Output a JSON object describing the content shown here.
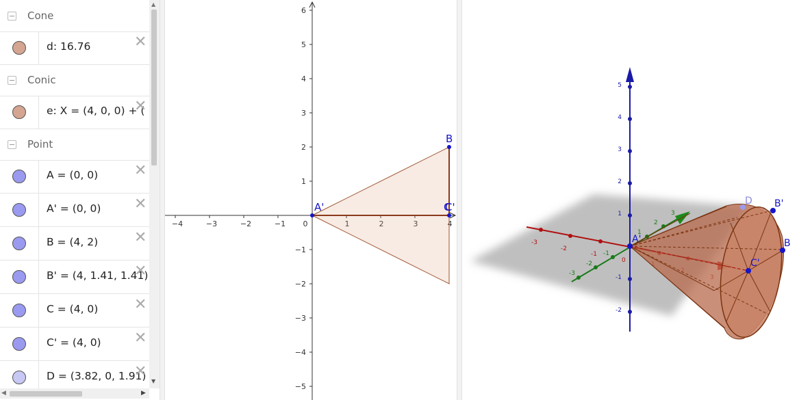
{
  "algebra": {
    "categories": [
      {
        "label": "Cone"
      },
      {
        "label": "Conic"
      },
      {
        "label": "Point"
      }
    ],
    "cone_items": [
      {
        "expr": "d: 16.76",
        "color": "#d4a590"
      }
    ],
    "conic_items": [
      {
        "expr": "e: X = (4, 0, 0) + (",
        "color": "#d4a590"
      }
    ],
    "point_items": [
      {
        "expr": "A = (0, 0)",
        "color": "#9a9af0"
      },
      {
        "expr": "A' = (0, 0)",
        "color": "#9a9af0"
      },
      {
        "expr": "B = (4, 2)",
        "color": "#9a9af0"
      },
      {
        "expr": "B' = (4, 1.41, 1.41)",
        "color": "#9a9af0"
      },
      {
        "expr": "C = (4, 0)",
        "color": "#9a9af0"
      },
      {
        "expr": "C' = (4, 0)",
        "color": "#9a9af0"
      },
      {
        "expr": "D = (3.82, 0, 1.91)",
        "color": "#c8c8f4"
      }
    ]
  },
  "graphics2d": {
    "x_ticks": [
      "−4",
      "−3",
      "−2",
      "−1",
      "0",
      "1",
      "2",
      "3",
      "4"
    ],
    "y_ticks_pos": [
      "6",
      "5",
      "4",
      "3",
      "2",
      "1"
    ],
    "y_ticks_neg": [
      "−1",
      "−2",
      "−3",
      "−4",
      "−5"
    ],
    "labels": {
      "A": "A'",
      "B": "B",
      "C": "C",
      "C2": "C'"
    }
  },
  "graphics3d": {
    "z_ticks": [
      "5",
      "4",
      "3",
      "2",
      "1",
      "-1",
      "-2"
    ],
    "x_ticks": [
      "-3",
      "-2",
      "-1",
      "1",
      "2",
      "3"
    ],
    "y_ticks": [
      "-3",
      "-2",
      "-1",
      "1",
      "2",
      "3"
    ],
    "origin": "0",
    "labels": {
      "A": "A'",
      "B": "B",
      "B2": "B'",
      "C2": "C'",
      "D": "D"
    }
  }
}
